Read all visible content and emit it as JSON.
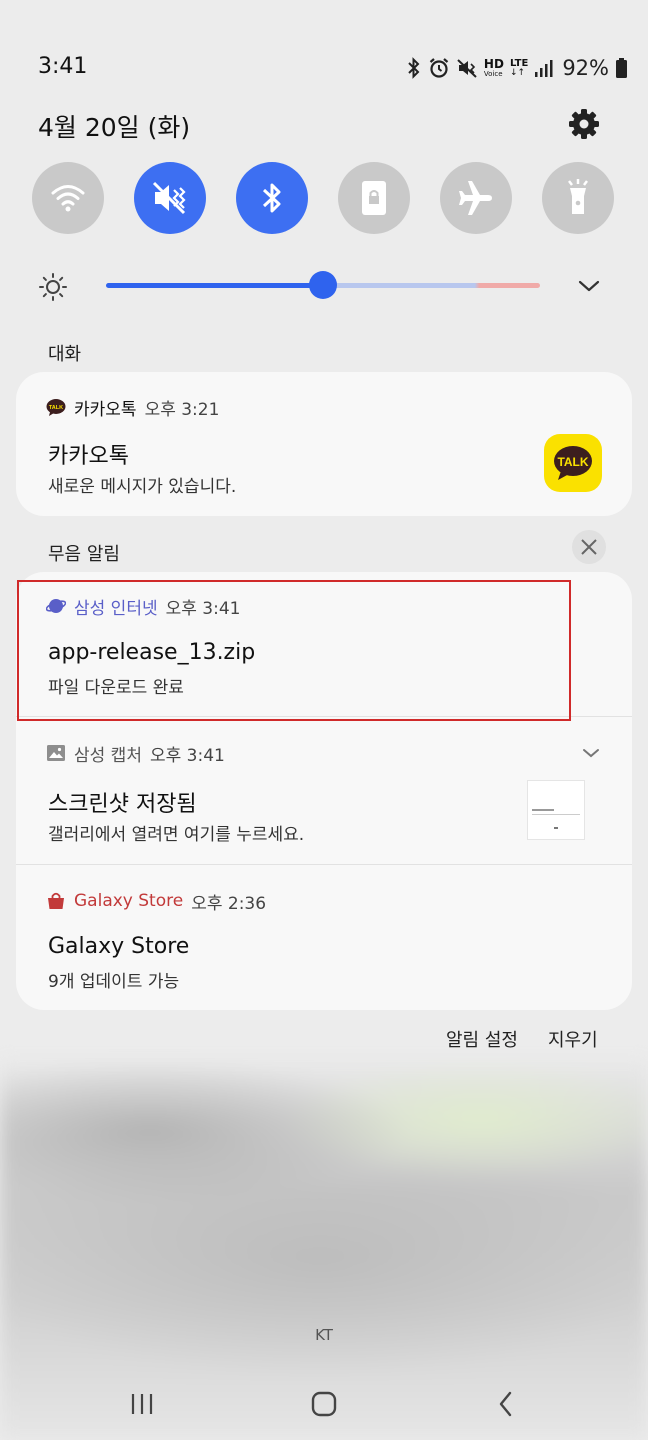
{
  "status_bar": {
    "time": "3:41",
    "hd_label": "HD",
    "voice_label": "Voice",
    "lte_label": "LTE",
    "battery": "92%"
  },
  "header": {
    "date": "4월 20일 (화)"
  },
  "quick_settings": [
    {
      "icon": "wifi-icon",
      "active": false
    },
    {
      "icon": "mute-icon",
      "active": true
    },
    {
      "icon": "bluetooth-icon",
      "active": true
    },
    {
      "icon": "rotation-lock-icon",
      "active": false
    },
    {
      "icon": "airplane-icon",
      "active": false
    },
    {
      "icon": "flashlight-icon",
      "active": false
    }
  ],
  "brightness": {
    "level": 0.5
  },
  "sections": {
    "conversations": "대화",
    "silent": "무음 알림"
  },
  "notifications": {
    "kakao": {
      "app": "카카오톡",
      "time": "오후 3:21",
      "title": "카카오톡",
      "text": "새로운 메시지가 있습니다.",
      "icon_label": "TALK",
      "small_icon_label": "TALK"
    },
    "internet": {
      "app": "삼성 인터넷",
      "time": "오후 3:41",
      "title": "app-release_13.zip",
      "text": "파일 다운로드 완료"
    },
    "capture": {
      "app": "삼성 캡처",
      "time": "오후 3:41",
      "title": "스크린샷 저장됨",
      "text": "갤러리에서 열려면 여기를 누르세요."
    },
    "store": {
      "app": "Galaxy Store",
      "time": "오후 2:36",
      "title": "Galaxy Store",
      "text": "9개 업데이트 가능"
    }
  },
  "actions": {
    "settings": "알림 설정",
    "clear": "지우기"
  },
  "carrier": "KT",
  "colors": {
    "accent": "#3d6ff2",
    "internet_app": "#5a5fc8",
    "store_app": "#c23a3a",
    "kakao_yellow": "#fae100",
    "highlight": "#d02a2a"
  }
}
